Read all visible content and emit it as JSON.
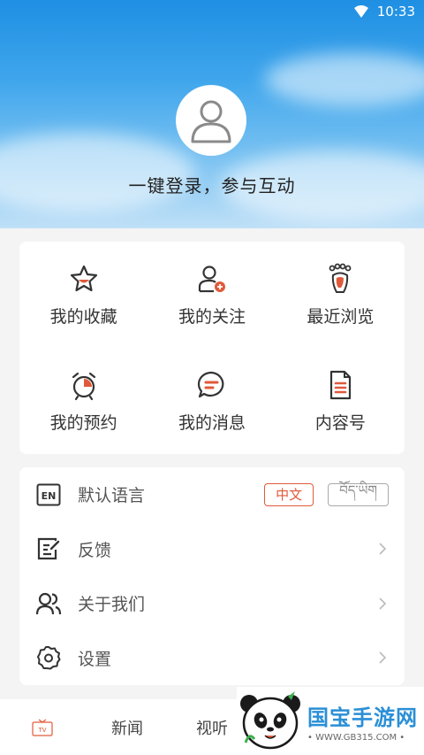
{
  "status_bar": {
    "time": "10:33"
  },
  "profile": {
    "login_text": "一键登录，参与互动"
  },
  "grid": [
    {
      "label": "我的收藏"
    },
    {
      "label": "我的关注"
    },
    {
      "label": "最近浏览"
    },
    {
      "label": "我的预约"
    },
    {
      "label": "我的消息"
    },
    {
      "label": "内容号"
    }
  ],
  "list": {
    "language": {
      "label": "默认语言",
      "option_zh": "中文",
      "option_bo": "བོད་ཡིག"
    },
    "feedback": {
      "label": "反馈"
    },
    "about": {
      "label": "关于我们"
    },
    "settings": {
      "label": "设置"
    }
  },
  "bottom_nav": {
    "tv_icon_text": "TV",
    "news": "新闻",
    "video": "视听"
  },
  "watermark": {
    "title": "国宝手游网",
    "url": "• WWW.GB315.COM •"
  },
  "colors": {
    "accent": "#e05a3a",
    "dark_icon": "#333333"
  }
}
